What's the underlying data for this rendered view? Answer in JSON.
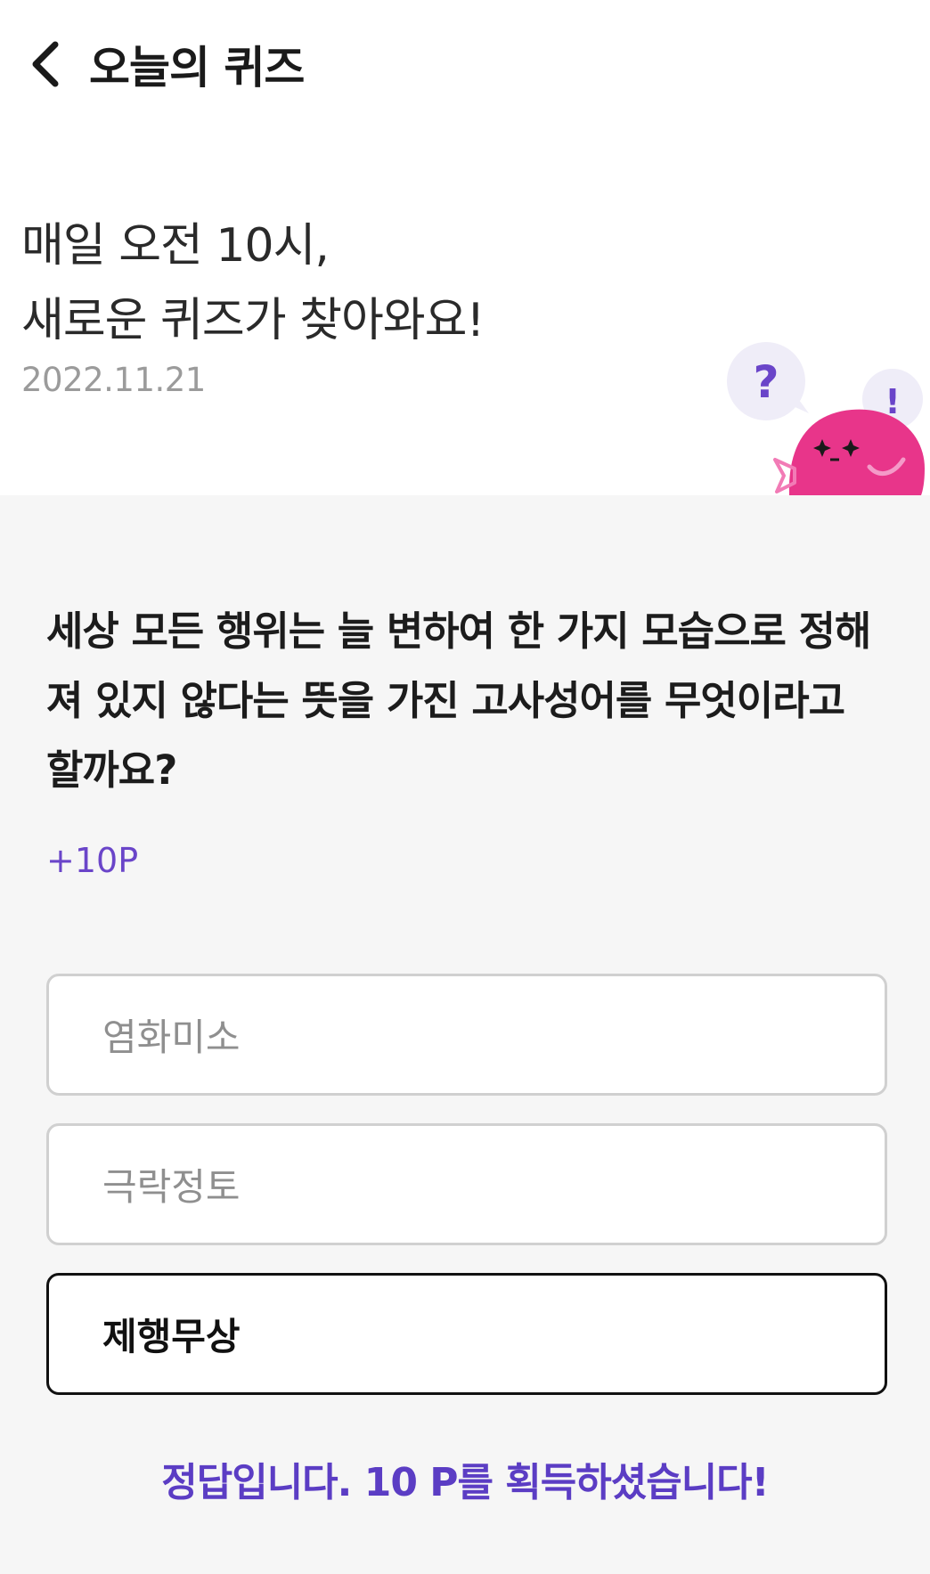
{
  "header": {
    "title": "오늘의 퀴즈",
    "back_icon": "chevron-left-icon"
  },
  "intro": {
    "line1": "매일 오전 10시,",
    "line2": "새로운 퀴즈가 찾아와요!",
    "date": "2022.11.21"
  },
  "mascot": {
    "question_mark": "?",
    "exclaim_mark": "!",
    "body_color": "#e8358a",
    "bubble_color": "#efedf8",
    "question_color": "#6a45c9",
    "exclaim_color": "#6a45c9"
  },
  "quiz": {
    "question": "세상 모든 행위는 늘 변하여 한 가지 모습으로 정해져 있지 않다는 뜻을 가진 고사성어를 무엇이라고 할까요?",
    "points": "+10P",
    "options": [
      {
        "label": "염화미소",
        "selected": false
      },
      {
        "label": "극락정토",
        "selected": false
      },
      {
        "label": "제행무상",
        "selected": true
      }
    ],
    "result": "정답입니다. 10 P를 획득하셨습니다!"
  },
  "colors": {
    "accent": "#5b3dc4",
    "background": "#f6f6f6"
  }
}
